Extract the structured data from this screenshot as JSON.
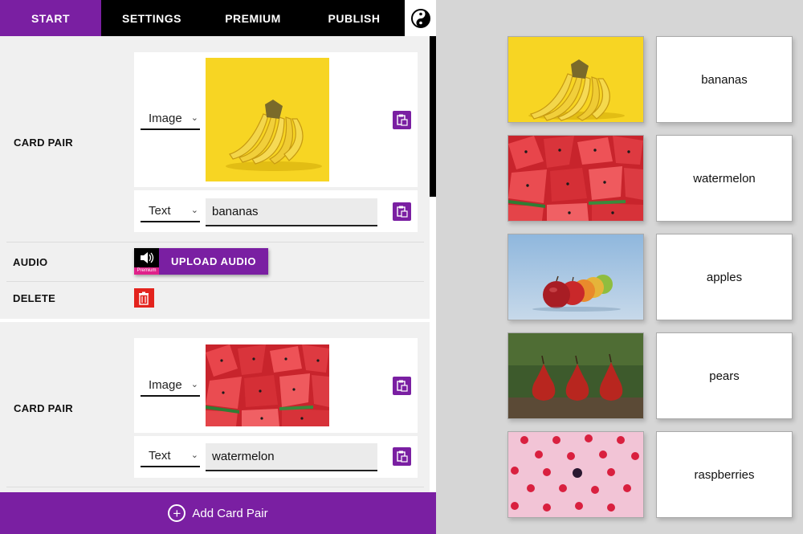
{
  "tabs": [
    "START",
    "SETTINGS",
    "PREMIUM",
    "PUBLISH"
  ],
  "editor": {
    "card_pair_label": "CARD PAIR",
    "audio_label": "AUDIO",
    "delete_label": "DELETE",
    "upload_audio_label": "UPLOAD AUDIO",
    "premium_badge": "Premium",
    "add_card_pair": "Add Card Pair",
    "pairs": [
      {
        "side_a_type": "Image",
        "side_b_type": "Text",
        "text_value": "bananas"
      },
      {
        "side_a_type": "Image",
        "side_b_type": "Text",
        "text_value": "watermelon"
      }
    ]
  },
  "preview": {
    "cards": [
      {
        "image": "bananas-image",
        "text": "bananas"
      },
      {
        "image": "watermelon-image",
        "text": "watermelon"
      },
      {
        "image": "apples-image",
        "text": "apples"
      },
      {
        "image": "pears-image",
        "text": "pears"
      },
      {
        "image": "raspberries-image",
        "text": "raspberries"
      }
    ]
  },
  "colors": {
    "accent": "#7a1fa2",
    "delete": "#e3231d",
    "premium": "#e0218a"
  }
}
